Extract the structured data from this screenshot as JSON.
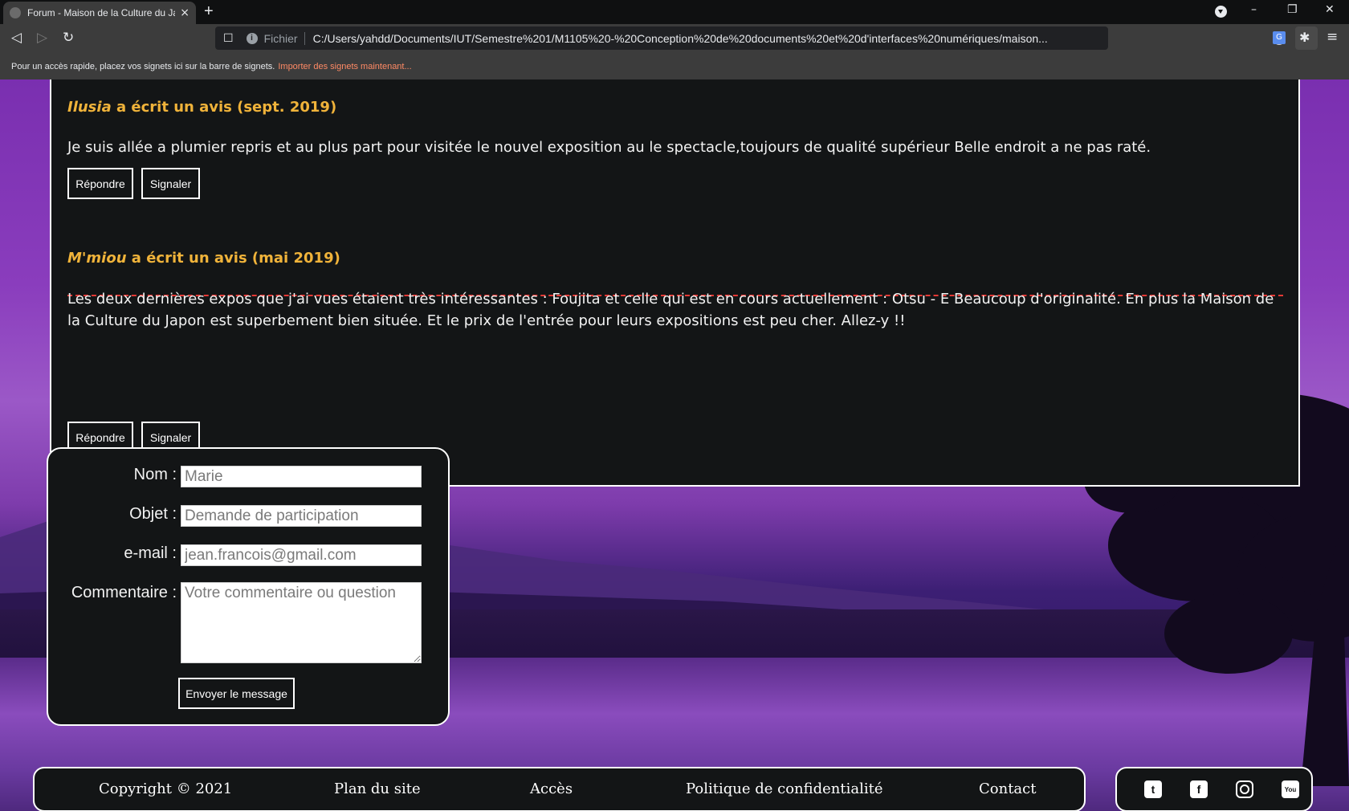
{
  "browser": {
    "tab_title": "Forum - Maison de la Culture du Japon",
    "tab_close": "×",
    "new_tab": "+",
    "window_min": "–",
    "window_restore": "❐",
    "window_close": "✕",
    "back": "◁",
    "forward": "▷",
    "reload": "↻",
    "bookmark": "☐",
    "scheme": "Fichier",
    "url": "C:/Users/yahdd/Documents/IUT/Semestre%201/M1105%20-%20Conception%20de%20documents%20et%20d'interfaces%20numériques/maison...",
    "translate": "G",
    "extensions": "✱",
    "menu": "≡",
    "bookmarks_prompt": "Pour un accès rapide, placez vos signets ici sur la barre de signets.",
    "bookmarks_import": "Importer des signets maintenant..."
  },
  "reviews": [
    {
      "author": "Ilusia",
      "title_rest": " a écrit un avis (sept. 2019)",
      "text": "Je suis allée a plumier repris et au plus part pour visitée le nouvel exposition au le spectacle,toujours de qualité supérieur Belle endroit a ne pas raté.",
      "reply_label": "Répondre",
      "report_label": "Signaler"
    },
    {
      "author": "M'miou",
      "title_rest": " a écrit un avis (mai 2019)",
      "text": "Les deux dernières expos que j'ai vues étaient très intéressantes : Foujita et celle qui est en cours actuellement : Otsu - E Beaucoup d'originalité. En plus la Maison de la Culture du Japon est superbement bien située. Et le prix de l'entrée pour leurs expositions est peu cher. Allez-y !!",
      "reply_label": "Répondre",
      "report_label": "Signaler"
    }
  ],
  "form": {
    "name_label": "Nom :",
    "name_placeholder": "Marie",
    "subject_label": "Objet :",
    "subject_placeholder": "Demande de participation",
    "email_label": "e-mail :",
    "email_placeholder": "jean.francois@gmail.com",
    "comment_label": "Commentaire :",
    "comment_placeholder": "Votre commentaire ou question",
    "submit_label": "Envoyer le message"
  },
  "footer": {
    "copyright": "Copyright © 2021",
    "sitemap": "Plan du site",
    "access": "Accès",
    "privacy": "Politique de confidentialité",
    "contact": "Contact"
  },
  "social": {
    "twitter": "t",
    "facebook": "f",
    "youtube": "You"
  },
  "colors": {
    "review_title": "#f0b33a",
    "divider": "#e53935",
    "panel_bg": "#131516",
    "import_link": "#ff8a65"
  }
}
